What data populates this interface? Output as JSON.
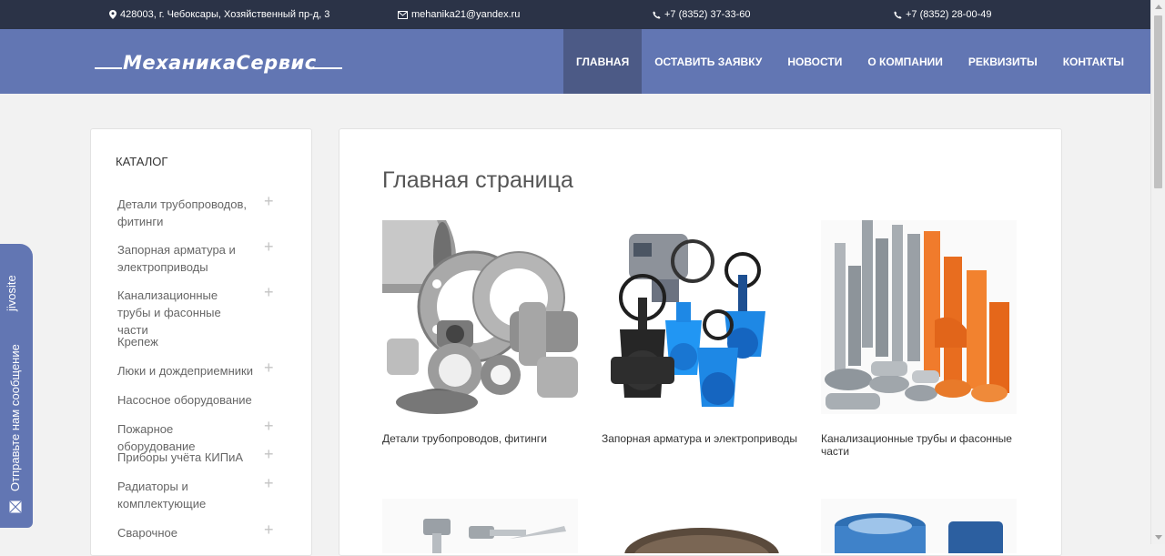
{
  "topbar": {
    "address": "428003, г. Чебоксары, Хозяйственный пр-д, 3",
    "email": "mehanika21@yandex.ru",
    "phone1": "+7 (8352) 37-33-60",
    "phone2": "+7 (8352) 28-00-49"
  },
  "logo": {
    "text": "МеханикаСервис"
  },
  "nav": [
    {
      "label": "Главная",
      "active": true
    },
    {
      "label": "Оставить заявку"
    },
    {
      "label": "Новости"
    },
    {
      "label": "О компании"
    },
    {
      "label": "Реквизиты"
    },
    {
      "label": "Контакты"
    }
  ],
  "sidebar": {
    "title": "Каталог",
    "items": [
      {
        "label": "Детали трубопроводов, фитинги",
        "has_children": true
      },
      {
        "label": "Запорная арматура и электроприводы",
        "has_children": true
      },
      {
        "label": "Канализационные трубы и фасонные части",
        "has_children": true
      },
      {
        "label": "Крепеж",
        "has_children": false
      },
      {
        "label": "Люки и дождеприемники",
        "has_children": true
      },
      {
        "label": "Насосное оборудование",
        "has_children": false
      },
      {
        "label": "Пожарное оборудование",
        "has_children": true
      },
      {
        "label": "Приборы учёта КИПиА",
        "has_children": true
      },
      {
        "label": "Радиаторы и комплектующие",
        "has_children": true
      },
      {
        "label": "Сварочное",
        "has_children": true
      }
    ]
  },
  "main": {
    "title": "Главная страница",
    "cards": [
      {
        "caption": "Детали трубопроводов, фитинги"
      },
      {
        "caption": "Запорная арматура и электроприводы"
      },
      {
        "caption": "Канализационные трубы и фасонные части"
      }
    ]
  },
  "jivo": {
    "brand": "jivosite",
    "message": "Отправьте нам сообщение"
  },
  "colors": {
    "topbar": "#2b3347",
    "header": "#6276b3",
    "nav_active": "#4c5a86",
    "background": "#f2f2f2"
  }
}
